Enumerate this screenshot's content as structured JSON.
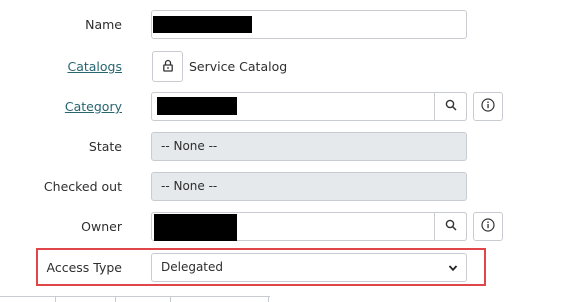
{
  "form": {
    "name": {
      "label": "Name",
      "value": ""
    },
    "catalogs": {
      "label": "Catalogs",
      "value": "Service Catalog",
      "icon": "lock-icon"
    },
    "category": {
      "label": "Category",
      "value": "",
      "search_icon": "search-icon",
      "info_icon": "info-icon"
    },
    "state": {
      "label": "State",
      "value": "-- None --"
    },
    "checked_out": {
      "label": "Checked out",
      "value": "-- None --"
    },
    "owner": {
      "label": "Owner",
      "value": "",
      "search_icon": "search-icon",
      "info_icon": "info-icon"
    },
    "access_type": {
      "label": "Access Type",
      "value": "Delegated",
      "icon": "chevron-down-icon"
    }
  },
  "colors": {
    "link": "#27656f",
    "highlight": "#e0454a",
    "readonly_bg": "#e6e9eb",
    "redaction": "#000000"
  }
}
